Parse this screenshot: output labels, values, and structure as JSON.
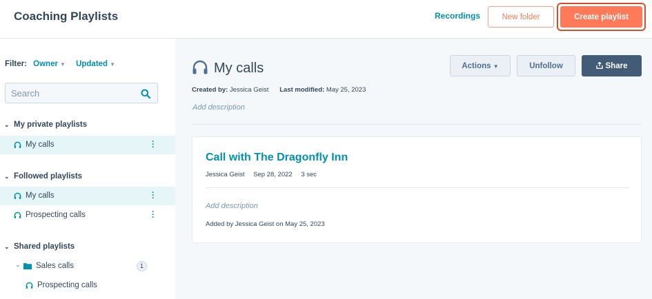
{
  "header": {
    "title": "Coaching Playlists",
    "recordings_link": "Recordings",
    "new_folder_label": "New folder",
    "create_playlist_label": "Create playlist"
  },
  "sidebar": {
    "filter": {
      "label": "Filter:",
      "owner": "Owner",
      "updated": "Updated"
    },
    "search": {
      "placeholder": "Search",
      "value": ""
    },
    "sections": [
      {
        "title": "My private playlists",
        "items": [
          {
            "label": "My calls",
            "active": true
          }
        ]
      },
      {
        "title": "Followed playlists",
        "items": [
          {
            "label": "My calls",
            "active": true
          },
          {
            "label": "Prospecting calls",
            "active": false
          }
        ]
      },
      {
        "title": "Shared playlists",
        "folder": {
          "label": "Sales calls",
          "count": "1",
          "items": [
            {
              "label": "Prospecting calls"
            }
          ]
        }
      }
    ]
  },
  "main": {
    "title": "My calls",
    "created_by_label": "Created by:",
    "created_by": "Jessica Geist",
    "last_modified_label": "Last modified:",
    "last_modified": "May 25, 2023",
    "add_description": "Add description",
    "actions_label": "Actions",
    "unfollow_label": "Unfollow",
    "share_label": "Share",
    "card": {
      "title": "Call with The Dragonfly Inn",
      "owner": "Jessica Geist",
      "date": "Sep 28, 2022",
      "duration": "3 sec",
      "add_description": "Add description",
      "added_by": "Added by Jessica Geist on May 25, 2023"
    }
  },
  "colors": {
    "accent": "#0091ae",
    "primary_button": "#ff7a59",
    "share_button": "#425b76",
    "active_item_bg": "#e5f5f8"
  }
}
